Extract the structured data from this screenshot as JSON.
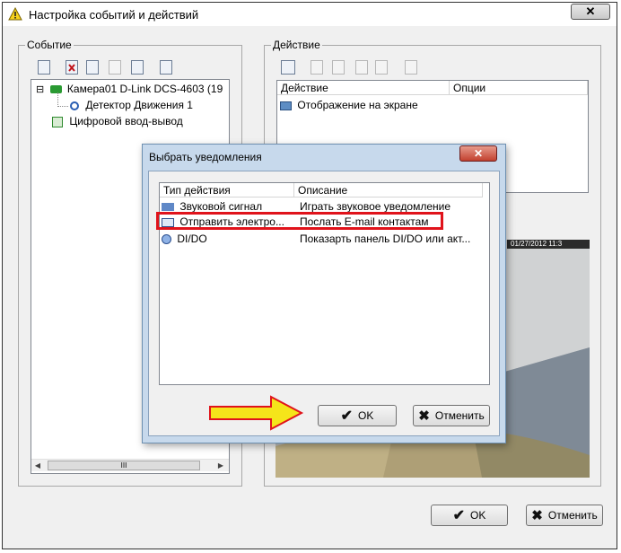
{
  "window": {
    "title": "Настройка событий и действий"
  },
  "event_group": {
    "legend": "Событие",
    "tree": [
      {
        "label": "Камера01 D-Link DCS-4603 (19",
        "expander": "⊟"
      },
      {
        "label": "Детектор Движения 1"
      },
      {
        "label": "Цифровой ввод-вывод"
      }
    ]
  },
  "action_group": {
    "legend": "Действие",
    "columns": [
      "Действие",
      "Опции"
    ],
    "rows": [
      {
        "action": "Отображение на экране",
        "options": ""
      }
    ]
  },
  "dialog": {
    "title": "Выбрать уведомления",
    "columns": [
      "Тип действия",
      "Описание"
    ],
    "rows": [
      {
        "type": "Звуковой сигнал",
        "description": "Играть звуковое уведомление"
      },
      {
        "type": "Отправить электро...",
        "description": "Послать E-mail контактам"
      },
      {
        "type": "DI/DO",
        "description": "Показарть панель DI/DO или акт..."
      }
    ],
    "ok_label": "OK",
    "cancel_label": "Отменить"
  },
  "camera_preview": {
    "timestamp": "01/27/2012 11:3"
  },
  "footer": {
    "ok_label": "OK",
    "cancel_label": "Отменить"
  },
  "scroll": {
    "grip": "III"
  },
  "colors": {
    "highlight": "#e0131b",
    "arrow": "#f5e51a"
  }
}
